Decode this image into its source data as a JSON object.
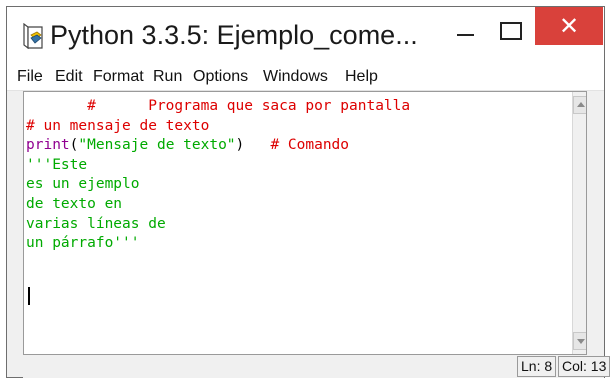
{
  "window": {
    "title": "Python 3.3.5: Ejemplo_come...",
    "icon": "python-idle-icon"
  },
  "menubar": {
    "items": [
      "File",
      "Edit",
      "Format",
      "Run",
      "Options",
      "Windows",
      "Help"
    ]
  },
  "editor": {
    "lines": [
      [
        {
          "text": "       #      Programa que saca por pantalla",
          "color": "red"
        }
      ],
      [
        {
          "text": "# un mensaje de texto",
          "color": "red"
        }
      ],
      [
        {
          "text": "print",
          "color": "purple"
        },
        {
          "text": "(",
          "color": "black"
        },
        {
          "text": "\"Mensaje de texto\"",
          "color": "green"
        },
        {
          "text": ")   ",
          "color": "black"
        },
        {
          "text": "# Comando",
          "color": "red"
        }
      ],
      [
        {
          "text": "'''Este",
          "color": "green"
        }
      ],
      [
        {
          "text": "es un ejemplo",
          "color": "green"
        }
      ],
      [
        {
          "text": "de texto en",
          "color": "green"
        }
      ],
      [
        {
          "text": "varias líneas de",
          "color": "green"
        }
      ],
      [
        {
          "text": "un párrafo'''",
          "color": "green"
        }
      ]
    ],
    "colors": {
      "red": "#dd0000",
      "purple": "#900090",
      "green": "#00aa00",
      "black": "#000000"
    }
  },
  "statusbar": {
    "line": "Ln: 8",
    "col": "Col: 13"
  },
  "colors": {
    "close_button": "#d9413b",
    "title_bg": "#ffffff",
    "chrome_bg": "#f0f0f0"
  }
}
